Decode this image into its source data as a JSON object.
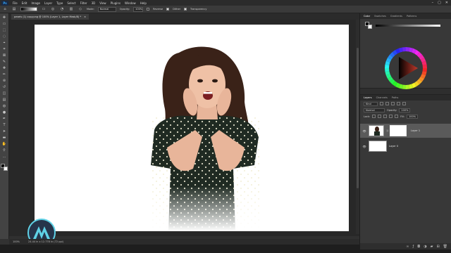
{
  "menubar": {
    "logo": "Ps",
    "items": [
      "File",
      "Edit",
      "Image",
      "Layer",
      "Type",
      "Select",
      "Filter",
      "3D",
      "View",
      "Plugins",
      "Window",
      "Help"
    ],
    "controls": [
      "–",
      "▢",
      "✕"
    ]
  },
  "options": {
    "mode_label": "Mode:",
    "mode_value": "Normal",
    "opacity_label": "Opacity:",
    "opacity_value": "100%",
    "reverse_label": "Reverse",
    "dither_label": "Dither",
    "transparency_label": "Transparency",
    "reverse_checked": false,
    "dither_checked": true,
    "transparency_checked": true
  },
  "document": {
    "tab_title": "pexels (1) copy.png @ 100% (Layer 1, Layer Mask/8) *",
    "tab_close": "×"
  },
  "status": {
    "zoom": "100%",
    "doc_info": "24.44 in x 12.778 in (72 ppi)"
  },
  "color_panel": {
    "tabs": [
      "Color",
      "Swatches",
      "Gradients",
      "Patterns"
    ],
    "active_tab": "Color",
    "wheel_accent": "#c0392b"
  },
  "layers_panel": {
    "tabs": [
      "Layers",
      "Channels",
      "Paths"
    ],
    "active_tab": "Layers",
    "filter_label": "Kind",
    "blend_mode": "Normal",
    "opacity_label": "Opacity:",
    "opacity_value": "100%",
    "lock_label": "Lock:",
    "fill_label": "Fill:",
    "fill_value": "100%",
    "layers": [
      {
        "name": "Layer 1",
        "selected": true,
        "has_mask": true
      },
      {
        "name": "Layer 0",
        "selected": false,
        "has_mask": false
      }
    ],
    "eye_glyph": "👁",
    "footer_icons": [
      "link-icon",
      "fx-icon",
      "mask-icon",
      "adjustment-icon",
      "group-icon",
      "new-layer-icon",
      "trash-icon"
    ]
  },
  "tools": [
    "move-icon",
    "artboard-icon",
    "marquee-icon",
    "lasso-icon",
    "quick-select-icon",
    "crop-icon",
    "frame-icon",
    "eyedropper-icon",
    "healing-icon",
    "brush-icon",
    "stamp-icon",
    "history-brush-icon",
    "eraser-icon",
    "gradient-icon",
    "blur-icon",
    "dodge-icon",
    "pen-icon",
    "type-icon",
    "path-select-icon",
    "shape-icon",
    "hand-icon",
    "zoom-icon",
    "more-icon"
  ],
  "tool_glyphs": [
    "✥",
    "▭",
    "⬚",
    "◌",
    "⌖",
    "⌗",
    "⊠",
    "✎",
    "✚",
    "✏",
    "⊛",
    "↺",
    "◫",
    "▤",
    "◍",
    "●",
    "✒",
    "T",
    "➤",
    "▬",
    "✋",
    "⚲",
    "…"
  ]
}
